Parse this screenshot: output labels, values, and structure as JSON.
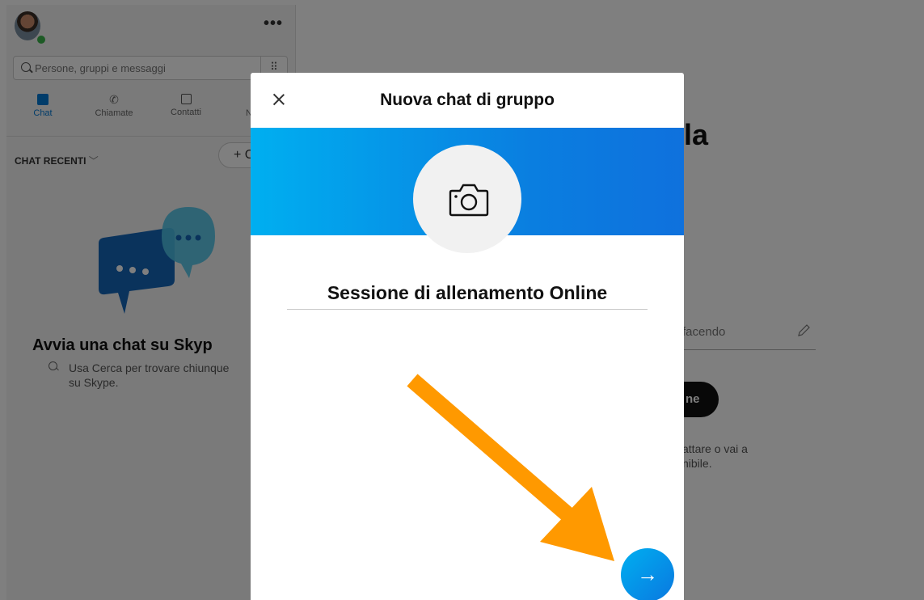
{
  "sidebar": {
    "search": {
      "placeholder": "Persone, gruppi e messaggi"
    },
    "more_label": "•••",
    "dialpad_label": "⠿",
    "tabs": [
      {
        "label": "Chat",
        "icon": "chat-icon",
        "active": true
      },
      {
        "label": "Chiamate",
        "icon": "phone-icon"
      },
      {
        "label": "Contatti",
        "icon": "contacts-icon"
      },
      {
        "label": "No",
        "icon": "bell-icon"
      }
    ],
    "recent_label": "CHAT RECENTI",
    "recent_chevron": "﹀",
    "new_chat_label": "+ C",
    "empty_state": {
      "title": "Avvia una chat su Skyp",
      "subtitle": "Usa Cerca per trovare chiunque su Skype."
    }
  },
  "main": {
    "title_fragment": "la",
    "mood_placeholder": "facendo",
    "button_fragment": "ne",
    "help_text_line1": "attare o vai a",
    "help_text_line2": "nibile."
  },
  "modal": {
    "title": "Nuova chat di gruppo",
    "group_name_value": "Sessione di allenamento Online",
    "next_label": "→",
    "close_icon": "close-icon",
    "camera_icon": "camera-icon"
  },
  "colors": {
    "accent": "#0078d4",
    "banner_start": "#00aff0",
    "banner_end": "#0f71dd",
    "annotation_arrow": "#ff9900",
    "presence": "#3bb54a"
  }
}
